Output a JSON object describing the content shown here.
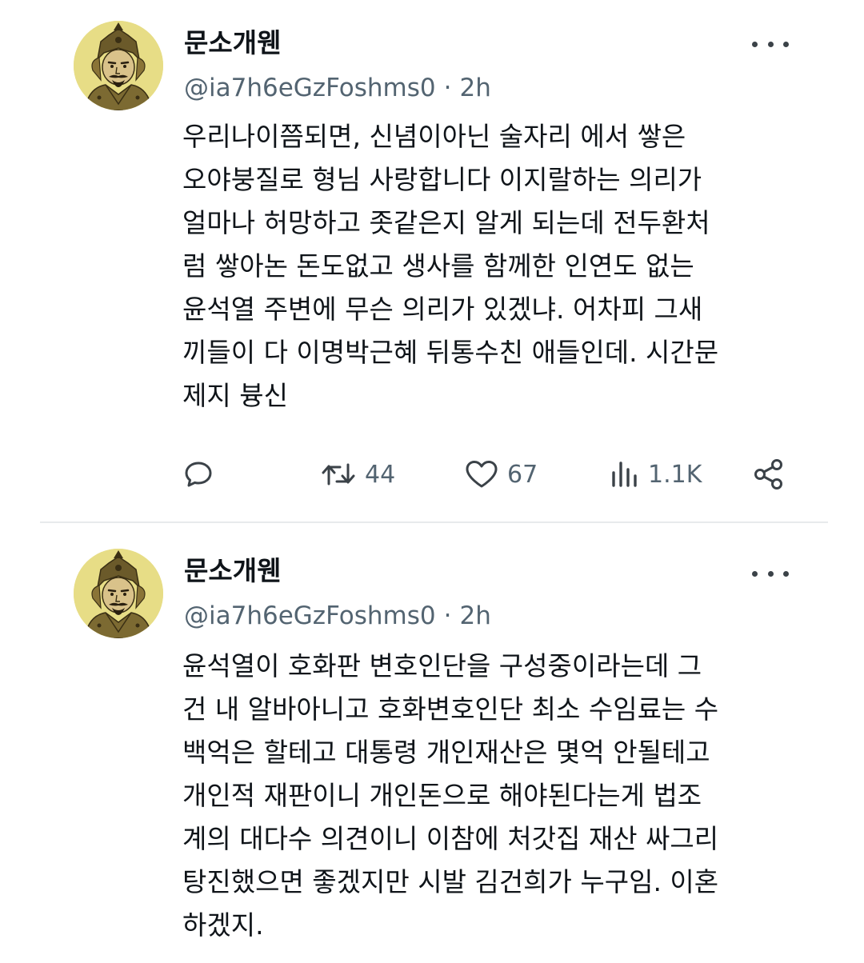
{
  "tweets": [
    {
      "author": {
        "display_name": "문소개웬",
        "handle": "@ia7h6eGzFoshms0",
        "avatar_icon": "general-portrait-avatar"
      },
      "separator": "·",
      "time": "2h",
      "text_lines": [
        "우리나이쯤되면, 신념이아닌 술자리  에서 쌓은",
        "오야붕질로 형님 사랑합니다 이지랄하는 의리가",
        "얼마나 허망하고 좃같은지 알게 되는데 전두환처",
        "럼 쌓아논 돈도없고 생사를 함께한 인연도 없는",
        "윤석열 주변에 무슨 의리가 있겠냐. 어차피 그새",
        "끼들이 다 이명박근혜 뒤통수친 애들인데. 시간문",
        "제지 븅신"
      ],
      "actions": {
        "reply_icon": "reply-icon",
        "repost_icon": "repost-icon",
        "repost_count": "44",
        "like_icon": "heart-icon",
        "like_count": "67",
        "views_icon": "views-icon",
        "views_count": "1.1K",
        "share_icon": "share-icon"
      }
    },
    {
      "author": {
        "display_name": "문소개웬",
        "handle": "@ia7h6eGzFoshms0",
        "avatar_icon": "general-portrait-avatar"
      },
      "separator": "·",
      "time": "2h",
      "text_lines": [
        "윤석열이 호화판 변호인단을 구성중이라는데 그",
        "건 내 알바아니고 호화변호인단 최소 수임료는 수",
        "백억은 할테고 대통령 개인재산은 몇억 안될테고",
        "개인적 재판이니 개인돈으로 해야된다는게 법조",
        "계의 대다수 의견이니 이참에 처갓집 재산 싸그리",
        "탕진했으면 좋겠지만 시발 김건희가 누구임. 이혼",
        "하겠지."
      ]
    }
  ],
  "colors": {
    "text_primary": "#0f1419",
    "text_secondary": "#536471",
    "avatar_background": "#e7dd86",
    "divider": "#e8eaec"
  }
}
